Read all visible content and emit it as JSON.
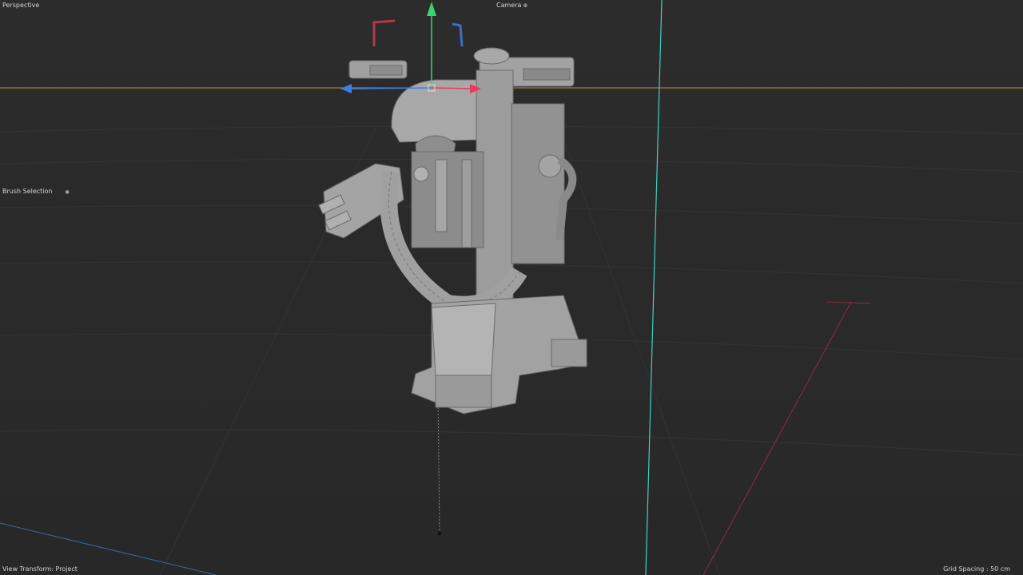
{
  "viewport": {
    "name": "Perspective",
    "camera_label": "Camera",
    "camera_icon": "camera-options-icon",
    "brush_label": "Brush Selection",
    "brush_icon": "chevron-icon",
    "view_transform": "View Transform: Project",
    "grid_spacing": "Grid Spacing : 50 cm"
  },
  "colors": {
    "background": "#2b2b2b",
    "horizon_line": "#c8902e",
    "axis_y_line": "#3fd3c0",
    "axis_x_red": "#e83a5c",
    "axis_y_green": "#3cd46a",
    "axis_z_blue": "#3c7ee8",
    "model_gray": "#9a9a9a"
  }
}
